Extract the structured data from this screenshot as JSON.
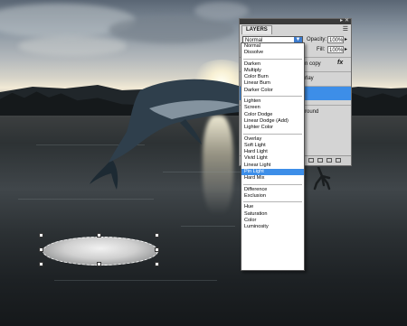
{
  "layers_panel": {
    "tab_label": "LAYERS",
    "blend_mode": "Normal",
    "opacity_label": "Opacity:",
    "opacity_value": "100%",
    "fill_label": "Fill:",
    "fill_value": "100%",
    "layers": [
      {
        "label": "n copy"
      },
      {
        "label": "rlay"
      },
      {
        "label": ""
      },
      {
        "label": "round"
      }
    ]
  },
  "blend_dropdown": {
    "groups": [
      [
        "Normal",
        "Dissolve"
      ],
      [
        "Darken",
        "Multiply",
        "Color Burn",
        "Linear Burn",
        "Darker Color"
      ],
      [
        "Lighten",
        "Screen",
        "Color Dodge",
        "Linear Dodge (Add)",
        "Lighter Color"
      ],
      [
        "Overlay",
        "Soft Light",
        "Hard Light",
        "Vivid Light",
        "Linear Light",
        "Pin Light",
        "Hard Mix"
      ],
      [
        "Difference",
        "Exclusion"
      ],
      [
        "Hue",
        "Saturation",
        "Color",
        "Luminosity"
      ]
    ],
    "selected": "Pin Light"
  },
  "colors": {
    "selection_blue": "#3d8ee8",
    "panel_bg": "#d4d4d4"
  }
}
